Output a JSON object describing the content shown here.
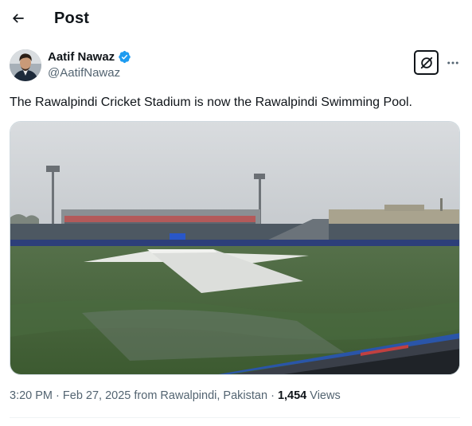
{
  "header": {
    "title": "Post",
    "back_icon": "arrow-left-icon"
  },
  "author": {
    "display_name": "Aatif Nawaz",
    "handle": "@AatifNawaz",
    "verified_color": "#1d9bf0",
    "grok_icon": "grok-icon",
    "more_icon": "more-horizontal-icon"
  },
  "post": {
    "text": "The Rawalpindi Cricket Stadium is now the Rawalpindi Swimming Pool.",
    "media_subject": "rain-covered cricket stadium"
  },
  "meta": {
    "time": "3:20 PM",
    "date": "Feb 27, 2025",
    "location": "from Rawalpindi, Pakistan",
    "separator": "·",
    "views_count": "1,454",
    "views_label": "Views"
  },
  "colors": {
    "text_primary": "#0f1419",
    "text_secondary": "#536471",
    "accent": "#1d9bf0",
    "border": "#cfd9de"
  }
}
